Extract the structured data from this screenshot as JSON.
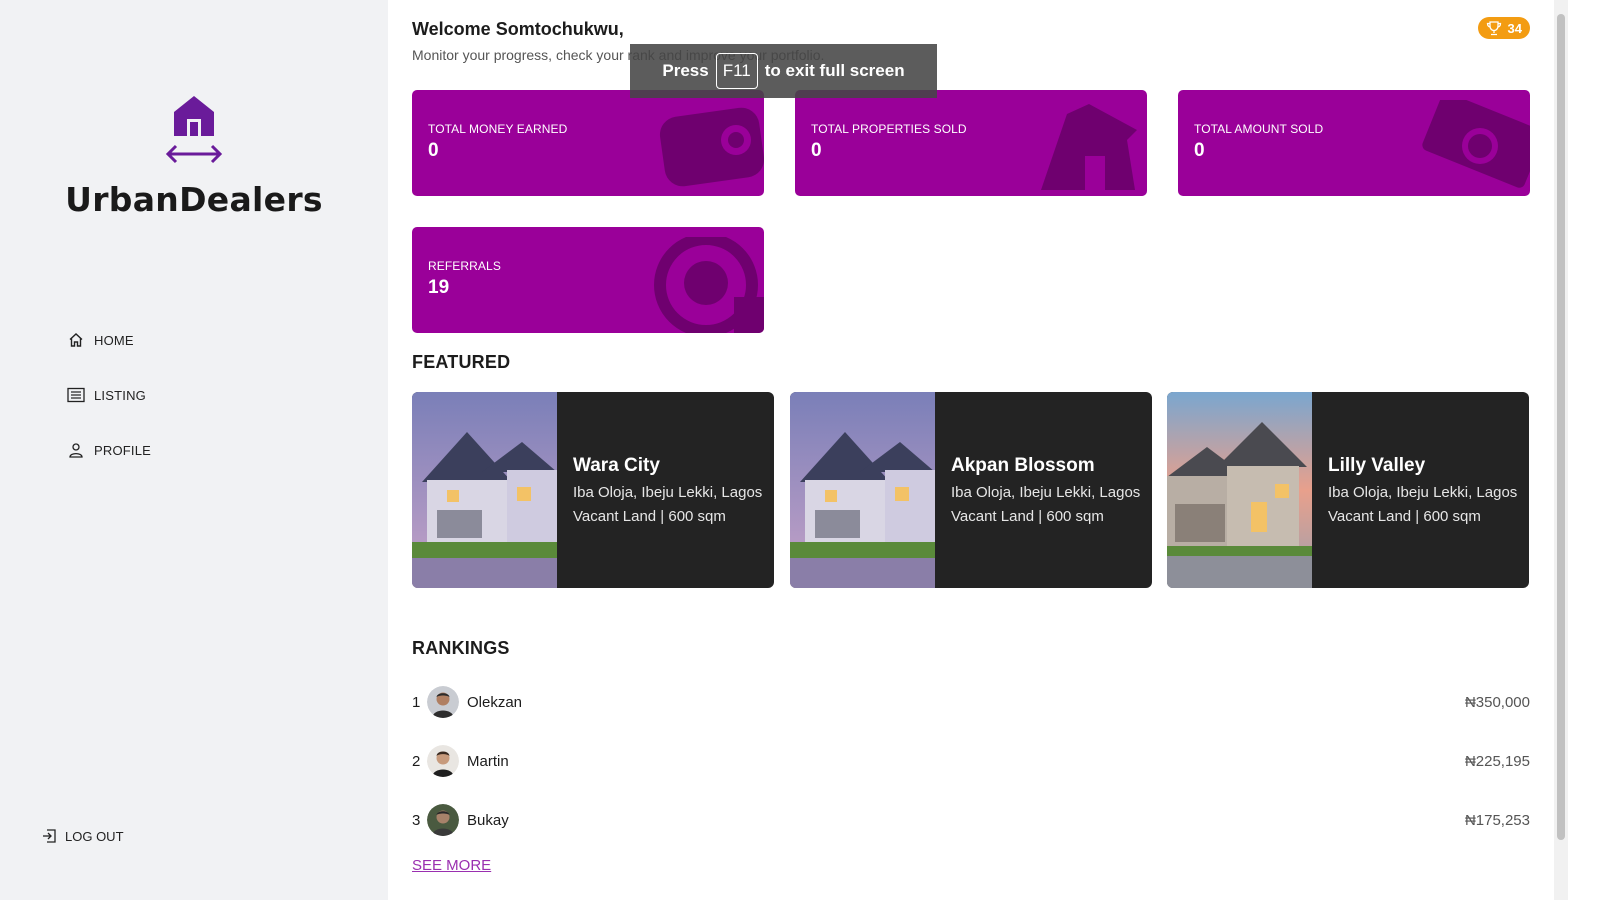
{
  "sidebar": {
    "brand": "UrbanDealers",
    "items": [
      {
        "label": "HOME",
        "icon": "home-icon"
      },
      {
        "label": "LISTING",
        "icon": "list-icon"
      },
      {
        "label": "PROFILE",
        "icon": "user-icon"
      }
    ],
    "logout": "LOG OUT"
  },
  "header": {
    "welcome": "Welcome Somtochukwu,",
    "subtitle": "Monitor your progress, check your rank and improve your portfolio.",
    "points": "34"
  },
  "fullscreen_toast": {
    "pre": "Press",
    "key": "F11",
    "post": "to exit full screen"
  },
  "stats": [
    {
      "label": "TOTAL MONEY EARNED",
      "value": "0",
      "icon": "wallet-icon"
    },
    {
      "label": "TOTAL PROPERTIES SOLD",
      "value": "0",
      "icon": "house-icon"
    },
    {
      "label": "TOTAL AMOUNT SOLD",
      "value": "0",
      "icon": "money-bill-icon"
    },
    {
      "label": "REFERRALS",
      "value": "19",
      "icon": "target-icon"
    }
  ],
  "featured": {
    "title": "FEATURED",
    "items": [
      {
        "name": "Wara City",
        "location": "Iba Oloja, Ibeju Lekki, Lagos",
        "type": "Vacant Land |",
        "size": "600 sqm"
      },
      {
        "name": "Akpan Blossom",
        "location": "Iba Oloja, Ibeju Lekki, Lagos",
        "type": "Vacant Land |",
        "size": "600 sqm"
      },
      {
        "name": "Lilly Valley",
        "location": "Iba Oloja, Ibeju Lekki, Lagos",
        "type": "Vacant Land |",
        "size": "600 sqm"
      }
    ]
  },
  "rankings": {
    "title": "RANKINGS",
    "rows": [
      {
        "rank": "1",
        "name": "Olekzan",
        "amount": "₦350,000"
      },
      {
        "rank": "2",
        "name": "Martin",
        "amount": "₦225,195"
      },
      {
        "rank": "3",
        "name": "Bukay",
        "amount": "₦175,253"
      }
    ],
    "see_more": "SEE MORE"
  },
  "colors": {
    "accent": "#9a0099",
    "brand_purple": "#6a1b9a",
    "badge": "#f39c12",
    "card_dark": "#232323"
  }
}
